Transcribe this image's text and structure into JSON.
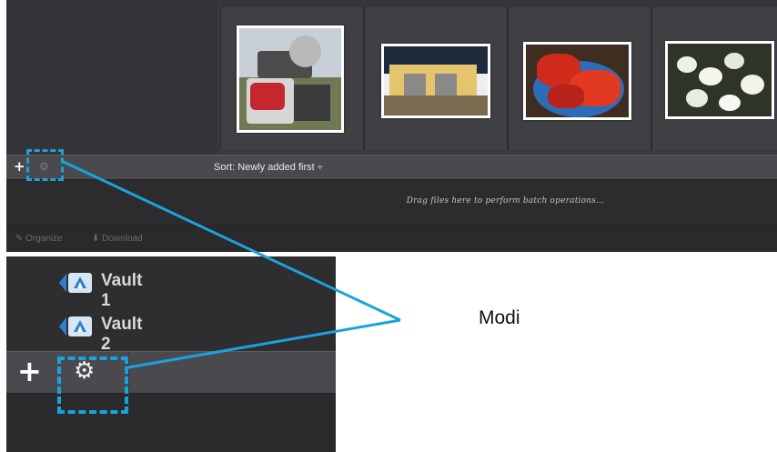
{
  "top_window": {
    "toolbar": {
      "add_label": "+",
      "sort_label": "Sort:",
      "sort_value": "Newly added first",
      "sort_chevron": "÷"
    },
    "dropzone": {
      "message": "Drag files here to perform batch operations..."
    },
    "bottom_bar": {
      "organize_label": "Organize",
      "download_label": "Download"
    },
    "thumbnails": [
      {
        "subject": "miter saw on stand with red cloth"
      },
      {
        "subject": "yellow building with garage doors"
      },
      {
        "subject": "red lobsters on blue plate"
      },
      {
        "subject": "white blossoms on branches"
      }
    ]
  },
  "zoom_panel": {
    "vaults": [
      {
        "label": "Vault 1"
      },
      {
        "label": "Vault 2"
      }
    ],
    "add_label": "+"
  },
  "callout": {
    "label": "Modi",
    "color": "#19a3dd"
  },
  "icons": [
    "plus-icon",
    "gear-icon",
    "vault-icon",
    "wrench-icon",
    "download-icon"
  ]
}
